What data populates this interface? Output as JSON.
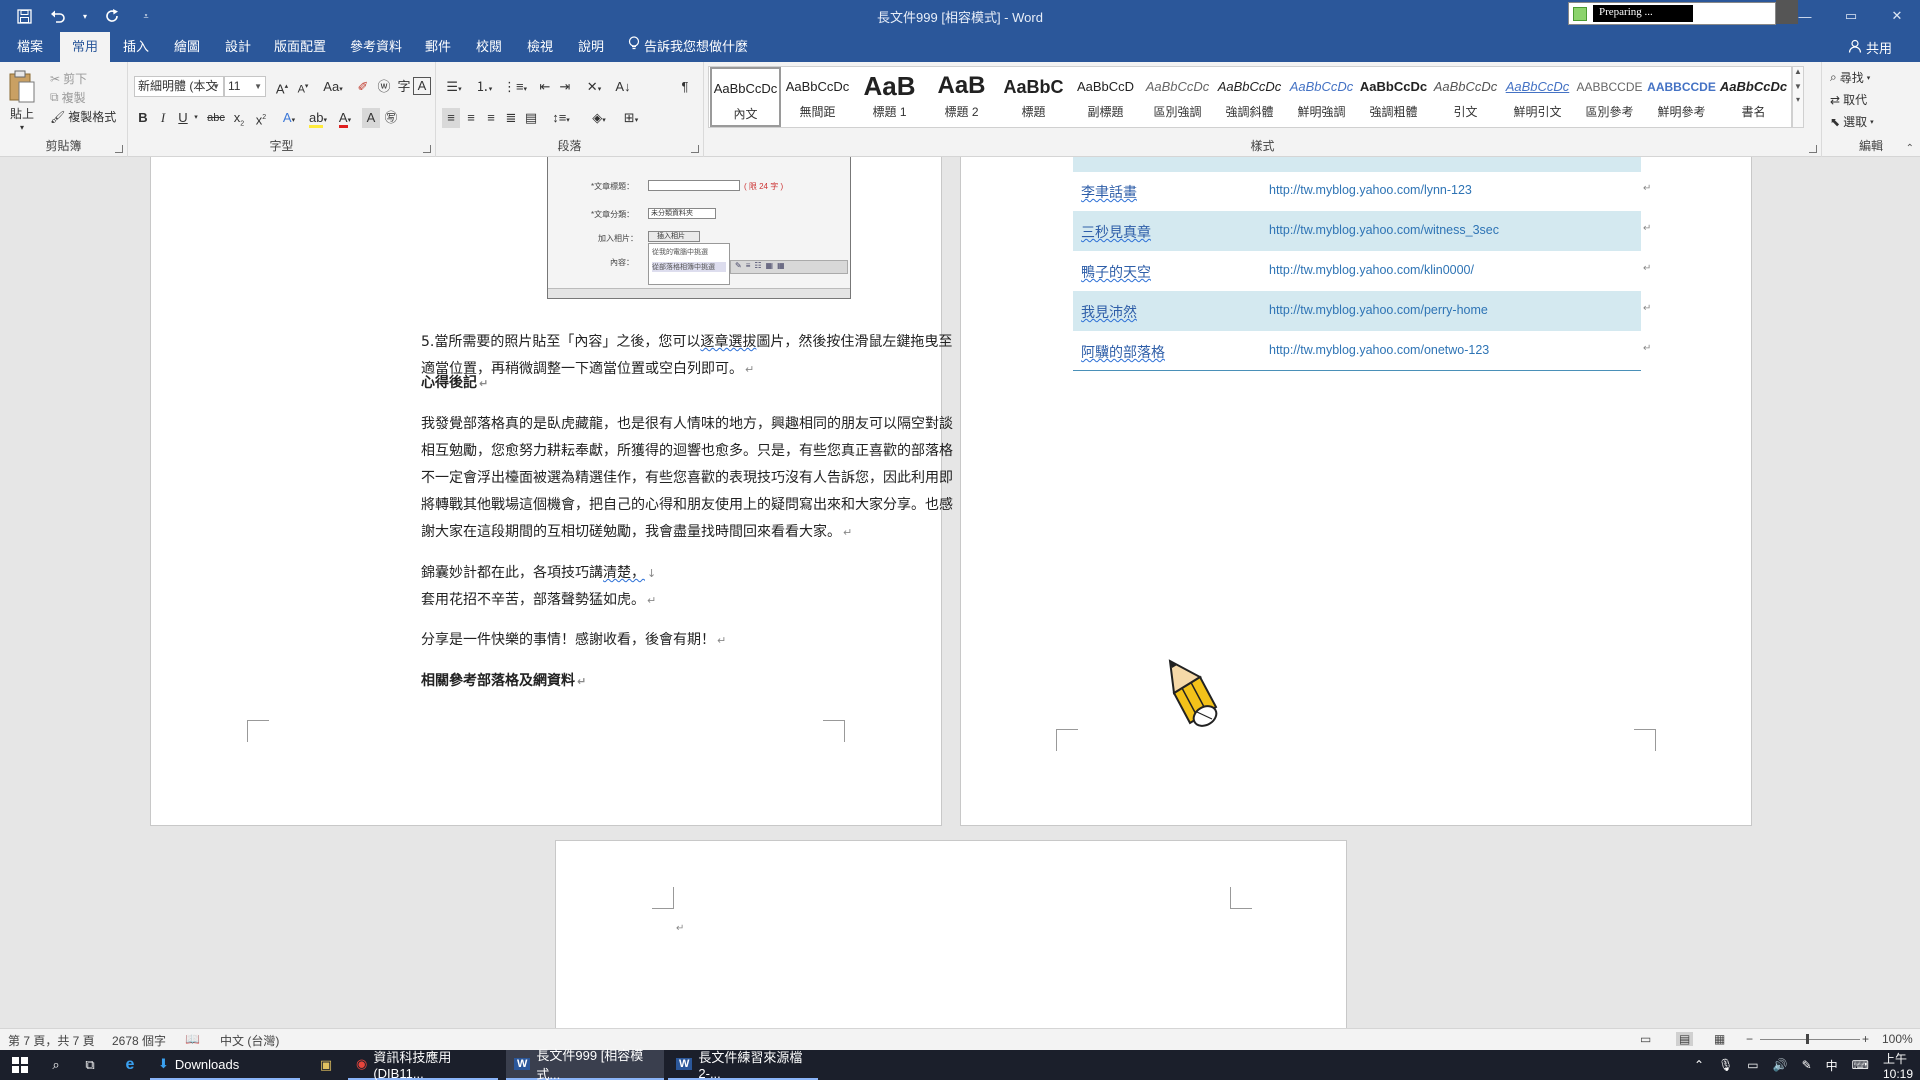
{
  "window": {
    "title": "長文件999 [相容模式] - Word",
    "preparing_text": "Preparing ..."
  },
  "qat": {
    "save": "save-icon",
    "undo": "undo-icon",
    "redo": "redo-icon",
    "customize": "customize-icon"
  },
  "tabs": [
    {
      "label": "檔案"
    },
    {
      "label": "常用"
    },
    {
      "label": "插入"
    },
    {
      "label": "繪圖"
    },
    {
      "label": "設計"
    },
    {
      "label": "版面配置"
    },
    {
      "label": "參考資料"
    },
    {
      "label": "郵件"
    },
    {
      "label": "校閱"
    },
    {
      "label": "檢視"
    },
    {
      "label": "說明"
    }
  ],
  "tellme": "告訴我您想做什麼",
  "share": "共用",
  "ribbon": {
    "clipboard": {
      "label": "剪貼簿",
      "paste": "貼上",
      "cut": "剪下",
      "copy": "複製",
      "format_painter": "複製格式"
    },
    "font": {
      "label": "字型",
      "font_name": "新細明體 (本文",
      "font_size": "11"
    },
    "paragraph": {
      "label": "段落"
    },
    "styles": {
      "label": "樣式",
      "items": [
        {
          "preview": "AaBbCcDc",
          "name": "內文"
        },
        {
          "preview": "AaBbCcDc",
          "name": "無間距"
        },
        {
          "preview": "AaB",
          "name": "標題 1"
        },
        {
          "preview": "AaB",
          "name": "標題 2"
        },
        {
          "preview": "AaBbC",
          "name": "標題"
        },
        {
          "preview": "AaBbCcD",
          "name": "副標題"
        },
        {
          "preview": "AaBbCcDc",
          "name": "區別強調"
        },
        {
          "preview": "AaBbCcDc",
          "name": "強調斜體"
        },
        {
          "preview": "AaBbCcDc",
          "name": "鮮明強調"
        },
        {
          "preview": "AaBbCcDc",
          "name": "強調粗體"
        },
        {
          "preview": "AaBbCcDc",
          "name": "引文"
        },
        {
          "preview": "AaBbCcDc",
          "name": "鮮明引文"
        },
        {
          "preview": "AABBCCDE",
          "name": "區別參考"
        },
        {
          "preview": "AABBCCDE",
          "name": "鮮明參考"
        },
        {
          "preview": "AaBbCcDc",
          "name": "書名"
        }
      ]
    },
    "editing": {
      "label": "編輯",
      "find": "尋找",
      "replace": "取代",
      "select": "選取"
    }
  },
  "left_page": {
    "screenshot": {
      "title_label": "*文章標題：",
      "title_hint": "( 限 24 字 )",
      "category_label": "*文章分類：",
      "category_value": "未分類資料夾",
      "insert_label": "加入相片：",
      "insert_button": "插入相片",
      "content_label": "內容：",
      "menu_item_1": "從我的電腦中挑選",
      "menu_item_2": "從部落格相簿中挑選"
    },
    "para_step5_a": "5.當所需要的照片貼至「內容」之後，您可以",
    "para_step5_sq": "逐章選拔",
    "para_step5_b": "圖片，然後按住滑鼠左鍵拖曳至",
    "para_step5_line2": "適當位置，再稍微調整一下適當位置或空白列即可。",
    "heading_notes": "心得後記",
    "notes_line1": "我發覺部落格真的是臥虎藏龍，也是很有人情味的地方，興趣相同的朋友可以隔空對談",
    "notes_line2": "相互勉勵，您愈努力耕耘奉獻，所獲得的迴響也愈多。只是，有些您真正喜歡的部落格",
    "notes_line3": "不一定會浮出檯面被選為精選佳作，有些您喜歡的表現技巧沒有人告訴您，因此利用即",
    "notes_line4": "將轉戰其他戰場這個機會，把自己的心得和朋友使用上的疑問寫出來和大家分享。也感",
    "notes_line5": "謝大家在這段期間的互相切磋勉勵，我會盡量找時間回來看看大家。",
    "poem_line1_a": "錦囊妙計都在此，各項技巧講",
    "poem_line1_sq": "清楚，",
    "poem_line2": "套用花招不辛苦，部落聲勢猛如虎。",
    "closing": "分享是一件快樂的事情！感謝收看，後會有期！",
    "heading_refs": "相關參考部落格及網資料"
  },
  "right_page": {
    "blogs": [
      {
        "name": "李聿話畫",
        "url": "http://tw.myblog.yahoo.com/lynn-123"
      },
      {
        "name": "三秒見真章",
        "url": "http://tw.myblog.yahoo.com/witness_3sec"
      },
      {
        "name": "鴨子的天空",
        "url": "http://tw.myblog.yahoo.com/klin0000/"
      },
      {
        "name": "我見沛然",
        "url": "http://tw.myblog.yahoo.com/perry-home"
      },
      {
        "name": "阿驥的部落格",
        "url": "http://tw.myblog.yahoo.com/onetwo-123"
      }
    ]
  },
  "statusbar": {
    "page": "第 7 頁，共 7 頁",
    "words": "2678 個字",
    "language": "中文 (台灣)",
    "zoom": "100%"
  },
  "taskbar": {
    "downloads": "Downloads",
    "apps": [
      {
        "label": "資訊科技應用 (DIB11..."
      },
      {
        "label": "長文件999 [相容模式..."
      },
      {
        "label": "長文件練習來源檔2-..."
      }
    ],
    "ime": "中",
    "time": "上午 10:19"
  }
}
